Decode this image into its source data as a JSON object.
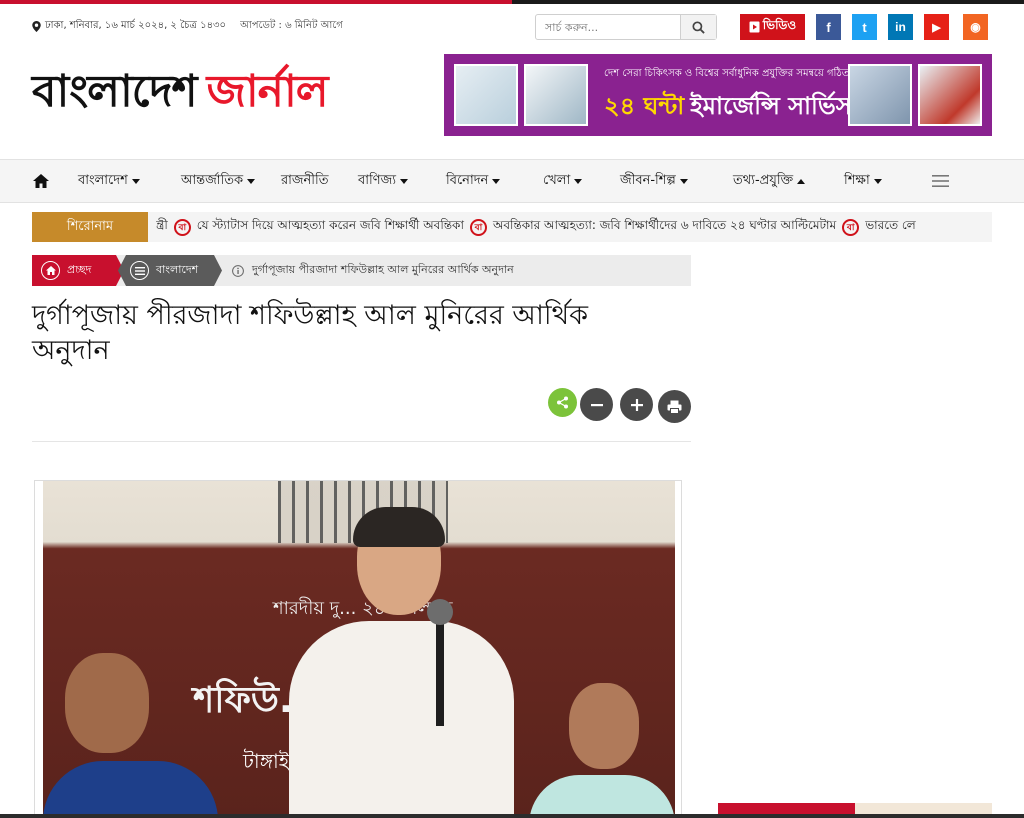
{
  "header": {
    "date_text": "ঢাকা, শনিবার, ১৬ মার্চ ২০২৪, ২ চৈত্র ১৪৩০",
    "update_text": "আপডেট : ৬ মিনিট আগে",
    "search": {
      "placeholder": "সার্চ করুন..."
    },
    "video_label": "ভিডিও",
    "social": [
      {
        "name": "facebook",
        "label": "f",
        "color": "#3b5998"
      },
      {
        "name": "twitter",
        "label": "t",
        "color": "#1da1f2"
      },
      {
        "name": "linkedin",
        "label": "in",
        "color": "#0077b5"
      },
      {
        "name": "youtube",
        "label": "▶",
        "color": "#e62117"
      },
      {
        "name": "rss",
        "label": "◉",
        "color": "#f26522"
      }
    ]
  },
  "logo": {
    "part1": "বাংলাদেশ",
    "part2": "জার্নাল"
  },
  "ad": {
    "subtitle": "দেশ সেরা চিকিৎসক ও বিশ্বের সর্বাধুনিক প্রযুক্তির সমন্বয়ে গঠিত",
    "title_highlight": "২৪ ঘন্টা",
    "title_rest": "ইমার্জেন্সি সার্ভিস"
  },
  "nav": {
    "items": [
      {
        "label": "বাংলাদেশ",
        "caret": "down"
      },
      {
        "label": "আন্তর্জাতিক",
        "caret": "down"
      },
      {
        "label": "রাজনীতি",
        "caret": ""
      },
      {
        "label": "বাণিজ্য",
        "caret": "down"
      },
      {
        "label": "বিনোদন",
        "caret": "down"
      },
      {
        "label": "খেলা",
        "caret": "down"
      },
      {
        "label": "জীবন-শিল্প",
        "caret": "down"
      },
      {
        "label": "তথ্য-প্রযুক্তি",
        "caret": "up"
      },
      {
        "label": "শিক্ষা",
        "caret": "down"
      }
    ]
  },
  "ticker": {
    "label": "শিরোনাম",
    "badge": "বা",
    "lead_fragment": "ন্ত্রী",
    "items": [
      "যে স্ট্যাটাস দিয়ে আত্মহত্যা করেন জবি শিক্ষার্থী অবন্তিকা",
      "অবন্তিকার আত্মহত্যা: জবি শিক্ষার্থীদের ৬ দাবিতে ২৪ ঘণ্টার আল্টিমেটাম",
      "ভারতে লে"
    ]
  },
  "breadcrumb": {
    "home": "প্রচ্ছদ",
    "section": "বাংলাদেশ",
    "current": "দুর্গাপূজায় পীরজাদা শফিউল্লাহ আল মুনিরের আর্থিক অনুদান"
  },
  "article": {
    "headline": "দুর্গাপূজায় পীরজাদা শফিউল্লাহ আল মুনিরের আর্থিক অনুদান"
  },
  "photo": {
    "banner_line1": "শারদীয় দু... ২৪ উপলক্ষে",
    "banner_line2": "শফিউ...            ...র কা",
    "banner_line3": "টাঙ্গাইল এর ... শ্রী শ্রী কালী"
  }
}
